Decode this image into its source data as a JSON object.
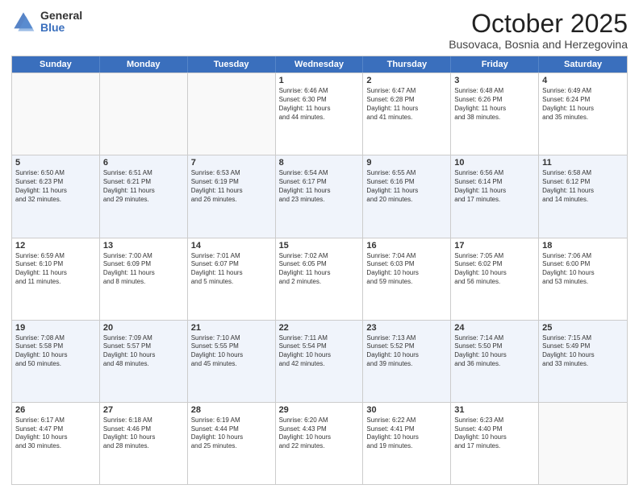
{
  "logo": {
    "general": "General",
    "blue": "Blue"
  },
  "header": {
    "month": "October 2025",
    "location": "Busovaca, Bosnia and Herzegovina"
  },
  "weekdays": [
    "Sunday",
    "Monday",
    "Tuesday",
    "Wednesday",
    "Thursday",
    "Friday",
    "Saturday"
  ],
  "rows": [
    [
      {
        "day": "",
        "lines": []
      },
      {
        "day": "",
        "lines": []
      },
      {
        "day": "",
        "lines": []
      },
      {
        "day": "1",
        "lines": [
          "Sunrise: 6:46 AM",
          "Sunset: 6:30 PM",
          "Daylight: 11 hours",
          "and 44 minutes."
        ]
      },
      {
        "day": "2",
        "lines": [
          "Sunrise: 6:47 AM",
          "Sunset: 6:28 PM",
          "Daylight: 11 hours",
          "and 41 minutes."
        ]
      },
      {
        "day": "3",
        "lines": [
          "Sunrise: 6:48 AM",
          "Sunset: 6:26 PM",
          "Daylight: 11 hours",
          "and 38 minutes."
        ]
      },
      {
        "day": "4",
        "lines": [
          "Sunrise: 6:49 AM",
          "Sunset: 6:24 PM",
          "Daylight: 11 hours",
          "and 35 minutes."
        ]
      }
    ],
    [
      {
        "day": "5",
        "lines": [
          "Sunrise: 6:50 AM",
          "Sunset: 6:23 PM",
          "Daylight: 11 hours",
          "and 32 minutes."
        ]
      },
      {
        "day": "6",
        "lines": [
          "Sunrise: 6:51 AM",
          "Sunset: 6:21 PM",
          "Daylight: 11 hours",
          "and 29 minutes."
        ]
      },
      {
        "day": "7",
        "lines": [
          "Sunrise: 6:53 AM",
          "Sunset: 6:19 PM",
          "Daylight: 11 hours",
          "and 26 minutes."
        ]
      },
      {
        "day": "8",
        "lines": [
          "Sunrise: 6:54 AM",
          "Sunset: 6:17 PM",
          "Daylight: 11 hours",
          "and 23 minutes."
        ]
      },
      {
        "day": "9",
        "lines": [
          "Sunrise: 6:55 AM",
          "Sunset: 6:16 PM",
          "Daylight: 11 hours",
          "and 20 minutes."
        ]
      },
      {
        "day": "10",
        "lines": [
          "Sunrise: 6:56 AM",
          "Sunset: 6:14 PM",
          "Daylight: 11 hours",
          "and 17 minutes."
        ]
      },
      {
        "day": "11",
        "lines": [
          "Sunrise: 6:58 AM",
          "Sunset: 6:12 PM",
          "Daylight: 11 hours",
          "and 14 minutes."
        ]
      }
    ],
    [
      {
        "day": "12",
        "lines": [
          "Sunrise: 6:59 AM",
          "Sunset: 6:10 PM",
          "Daylight: 11 hours",
          "and 11 minutes."
        ]
      },
      {
        "day": "13",
        "lines": [
          "Sunrise: 7:00 AM",
          "Sunset: 6:09 PM",
          "Daylight: 11 hours",
          "and 8 minutes."
        ]
      },
      {
        "day": "14",
        "lines": [
          "Sunrise: 7:01 AM",
          "Sunset: 6:07 PM",
          "Daylight: 11 hours",
          "and 5 minutes."
        ]
      },
      {
        "day": "15",
        "lines": [
          "Sunrise: 7:02 AM",
          "Sunset: 6:05 PM",
          "Daylight: 11 hours",
          "and 2 minutes."
        ]
      },
      {
        "day": "16",
        "lines": [
          "Sunrise: 7:04 AM",
          "Sunset: 6:03 PM",
          "Daylight: 10 hours",
          "and 59 minutes."
        ]
      },
      {
        "day": "17",
        "lines": [
          "Sunrise: 7:05 AM",
          "Sunset: 6:02 PM",
          "Daylight: 10 hours",
          "and 56 minutes."
        ]
      },
      {
        "day": "18",
        "lines": [
          "Sunrise: 7:06 AM",
          "Sunset: 6:00 PM",
          "Daylight: 10 hours",
          "and 53 minutes."
        ]
      }
    ],
    [
      {
        "day": "19",
        "lines": [
          "Sunrise: 7:08 AM",
          "Sunset: 5:58 PM",
          "Daylight: 10 hours",
          "and 50 minutes."
        ]
      },
      {
        "day": "20",
        "lines": [
          "Sunrise: 7:09 AM",
          "Sunset: 5:57 PM",
          "Daylight: 10 hours",
          "and 48 minutes."
        ]
      },
      {
        "day": "21",
        "lines": [
          "Sunrise: 7:10 AM",
          "Sunset: 5:55 PM",
          "Daylight: 10 hours",
          "and 45 minutes."
        ]
      },
      {
        "day": "22",
        "lines": [
          "Sunrise: 7:11 AM",
          "Sunset: 5:54 PM",
          "Daylight: 10 hours",
          "and 42 minutes."
        ]
      },
      {
        "day": "23",
        "lines": [
          "Sunrise: 7:13 AM",
          "Sunset: 5:52 PM",
          "Daylight: 10 hours",
          "and 39 minutes."
        ]
      },
      {
        "day": "24",
        "lines": [
          "Sunrise: 7:14 AM",
          "Sunset: 5:50 PM",
          "Daylight: 10 hours",
          "and 36 minutes."
        ]
      },
      {
        "day": "25",
        "lines": [
          "Sunrise: 7:15 AM",
          "Sunset: 5:49 PM",
          "Daylight: 10 hours",
          "and 33 minutes."
        ]
      }
    ],
    [
      {
        "day": "26",
        "lines": [
          "Sunrise: 6:17 AM",
          "Sunset: 4:47 PM",
          "Daylight: 10 hours",
          "and 30 minutes."
        ]
      },
      {
        "day": "27",
        "lines": [
          "Sunrise: 6:18 AM",
          "Sunset: 4:46 PM",
          "Daylight: 10 hours",
          "and 28 minutes."
        ]
      },
      {
        "day": "28",
        "lines": [
          "Sunrise: 6:19 AM",
          "Sunset: 4:44 PM",
          "Daylight: 10 hours",
          "and 25 minutes."
        ]
      },
      {
        "day": "29",
        "lines": [
          "Sunrise: 6:20 AM",
          "Sunset: 4:43 PM",
          "Daylight: 10 hours",
          "and 22 minutes."
        ]
      },
      {
        "day": "30",
        "lines": [
          "Sunrise: 6:22 AM",
          "Sunset: 4:41 PM",
          "Daylight: 10 hours",
          "and 19 minutes."
        ]
      },
      {
        "day": "31",
        "lines": [
          "Sunrise: 6:23 AM",
          "Sunset: 4:40 PM",
          "Daylight: 10 hours",
          "and 17 minutes."
        ]
      },
      {
        "day": "",
        "lines": []
      }
    ]
  ]
}
